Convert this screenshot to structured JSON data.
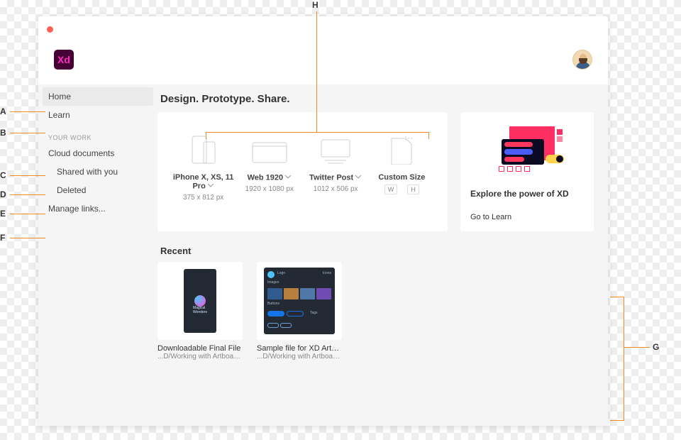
{
  "annotations": [
    "A",
    "B",
    "C",
    "D",
    "E",
    "F",
    "G",
    "H"
  ],
  "logo_text": "Xd",
  "sidebar": {
    "items": [
      {
        "label": "Home"
      },
      {
        "label": "Learn"
      }
    ],
    "section_label": "YOUR WORK",
    "work_items": [
      {
        "label": "Cloud documents"
      },
      {
        "label": "Shared with you"
      },
      {
        "label": "Deleted"
      },
      {
        "label": "Manage links..."
      }
    ]
  },
  "tagline": "Design. Prototype. Share.",
  "presets": [
    {
      "label": "iPhone X, XS, 11 Pro",
      "dim": "375 x 812 px",
      "chevron": true
    },
    {
      "label": "Web 1920",
      "dim": "1920 x 1080 px",
      "chevron": true
    },
    {
      "label": "Twitter Post",
      "dim": "1012 x 506 px",
      "chevron": true
    },
    {
      "label": "Custom Size",
      "w": "W",
      "h": "H",
      "chevron": false
    }
  ],
  "promo": {
    "title": "Explore the power of XD",
    "link": "Go to Learn"
  },
  "recent_title": "Recent",
  "recent": [
    {
      "name": "Downloadable Final File",
      "path": "...D/Working with Artboards"
    },
    {
      "name": "Sample file for XD Artb...",
      "path": "...D/Working with Artboards"
    }
  ]
}
